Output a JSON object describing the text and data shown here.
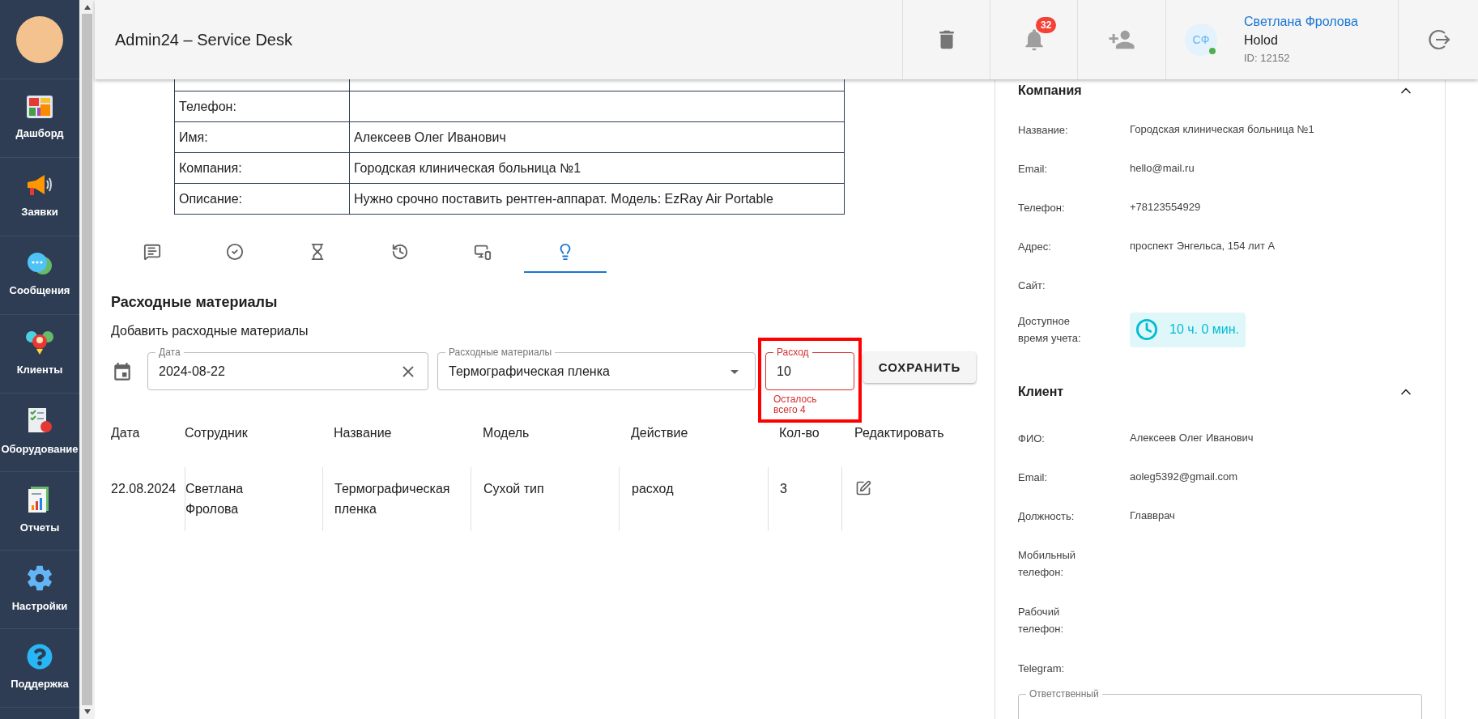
{
  "sidebar": {
    "items": [
      {
        "kind": "dashboard",
        "label": "Дашборд"
      },
      {
        "kind": "megaphone",
        "label": "Заявки"
      },
      {
        "kind": "chat",
        "label": "Сообщения"
      },
      {
        "kind": "clients",
        "label": "Клиенты"
      },
      {
        "kind": "equipment",
        "label": "Оборудование"
      },
      {
        "kind": "reports",
        "label": "Отчеты"
      },
      {
        "kind": "settings",
        "label": "Настройки"
      },
      {
        "kind": "support",
        "label": "Поддержка"
      }
    ]
  },
  "header": {
    "title": "Admin24 – Service Desk",
    "notifications": "32",
    "user": {
      "initials": "СФ",
      "name": "Светлана Фролова",
      "company": "Holod",
      "id": "ID: 12152",
      "online": true
    }
  },
  "request_table": {
    "rows": [
      {
        "label": "Телефон:"
      },
      {
        "label": "Имя:",
        "value": "Алексеев Олег Иванович"
      },
      {
        "label": "Компания:",
        "value": "Городская клиническая больница №1"
      },
      {
        "label": "Описание:",
        "value": "Нужно срочно поставить рентген-аппарат. Модель: EzRay Air Portable"
      }
    ]
  },
  "tabs": [
    {
      "kind": "comments",
      "selected": false
    },
    {
      "kind": "check",
      "selected": false
    },
    {
      "kind": "hourglass",
      "selected": false
    },
    {
      "kind": "history",
      "selected": false
    },
    {
      "kind": "devices",
      "selected": false
    },
    {
      "kind": "lightbulb",
      "selected": true
    }
  ],
  "consumables": {
    "title": "Расходные материалы",
    "subtitle": "Добавить расходные материалы",
    "date_field": {
      "label": "Дата",
      "value": "2024-08-22"
    },
    "material_field": {
      "label": "Расходные материалы",
      "value": "Термографическая пленка"
    },
    "amount_field": {
      "label": "Расход",
      "value": "10",
      "helper": "Осталось всего 4",
      "error": true,
      "highlighted": true
    },
    "save_button": "СОХРАНИТЬ",
    "table": {
      "columns": [
        "Дата",
        "Сотрудник",
        "Название",
        "Модель",
        "Действие",
        "Кол-во",
        "Редактировать"
      ],
      "rows": [
        {
          "cells": [
            "22.08.2024",
            "Светлана Фролова",
            "Термографическая пленка",
            "Сухой тип",
            "расход",
            "3"
          ]
        }
      ]
    }
  },
  "right_panel": {
    "sections": [
      {
        "title": "Компания",
        "expanded": true,
        "fields": [
          {
            "kind": "text",
            "label": "Название:",
            "value": "Городская клиническая больница №1"
          },
          {
            "kind": "text",
            "label": "Email:",
            "value": "hello@mail.ru"
          },
          {
            "kind": "text",
            "label": "Телефон:",
            "value": "+78123554929"
          },
          {
            "kind": "text",
            "label": "Адрес:",
            "value": "проспект Энгельса, 154 лит А"
          },
          {
            "kind": "text",
            "label": "Сайт:"
          },
          {
            "kind": "time",
            "label": "Доступное время учета:",
            "value": "10 ч. 0 мин."
          }
        ]
      },
      {
        "title": "Клиент",
        "expanded": true,
        "fields": [
          {
            "kind": "text",
            "label": "ФИО:",
            "value": "Алексеев Олег Иванович"
          },
          {
            "kind": "text",
            "label": "Email:",
            "value": "aoleg5392@gmail.com"
          },
          {
            "kind": "text",
            "label": "Должность:",
            "value": "Главврач"
          },
          {
            "kind": "text",
            "label": "Мобильный телефон:"
          },
          {
            "kind": "text",
            "label": "Рабочий телефон:"
          },
          {
            "kind": "text",
            "label": "Telegram:"
          }
        ]
      }
    ],
    "responsible_field": {
      "label": "Ответственный"
    }
  }
}
